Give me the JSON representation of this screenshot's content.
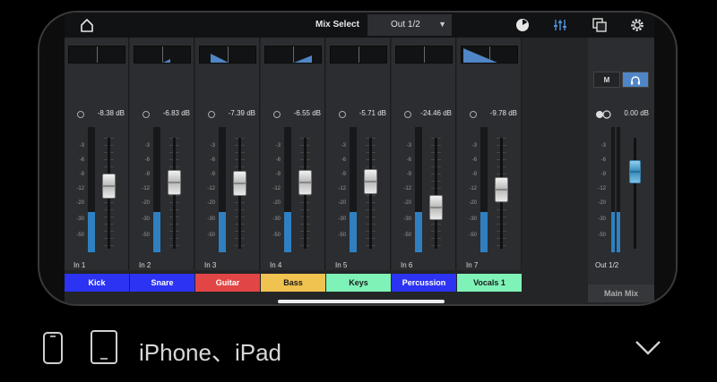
{
  "topbar": {
    "mix_select_label": "Mix Select",
    "output_value": "Out 1/2",
    "icons": [
      "home-icon",
      "knob-icon",
      "faders-icon",
      "copy-icon",
      "gear-icon"
    ]
  },
  "channels": [
    {
      "name": "Kick",
      "input": "In 1",
      "db": "-8.38 dB",
      "color": "#2c33f2",
      "text_color": "#ffffff",
      "fader_level": 0.58,
      "meter_level": 0.32,
      "pan": "center"
    },
    {
      "name": "Snare",
      "input": "In 2",
      "db": "-6.83 dB",
      "color": "#2c33f2",
      "text_color": "#ffffff",
      "fader_level": 0.62,
      "meter_level": 0.32,
      "pan": "slight-right"
    },
    {
      "name": "Guitar",
      "input": "In 3",
      "db": "-7.39 dB",
      "color": "#e24545",
      "text_color": "#ffffff",
      "fader_level": 0.61,
      "meter_level": 0.32,
      "pan": "left"
    },
    {
      "name": "Bass",
      "input": "In 4",
      "db": "-6.55 dB",
      "color": "#f0c24f",
      "text_color": "#1a1a1a",
      "fader_level": 0.62,
      "meter_level": 0.32,
      "pan": "right"
    },
    {
      "name": "Keys",
      "input": "In 5",
      "db": "-5.71 dB",
      "color": "#7ff2b7",
      "text_color": "#1a1a1a",
      "fader_level": 0.64,
      "meter_level": 0.32,
      "pan": "center"
    },
    {
      "name": "Percussion",
      "input": "In 6",
      "db": "-24.46 dB",
      "color": "#2c33f2",
      "text_color": "#ffffff",
      "fader_level": 0.33,
      "meter_level": 0.32,
      "pan": "center"
    },
    {
      "name": "Vocals 1",
      "input": "In 7",
      "db": "-9.78 dB",
      "color": "#7ff2b7",
      "text_color": "#1a1a1a",
      "fader_level": 0.54,
      "meter_level": 0.32,
      "pan": "wide-left"
    }
  ],
  "scale_labels": [
    "-3",
    "-6",
    "-9",
    "-12",
    "-20",
    "-30",
    "-50"
  ],
  "master": {
    "mute_label": "M",
    "monitor_icon": "headphones-icon",
    "db": "0.00 dB",
    "output": "Out 1/2",
    "name": "Main Mix",
    "fader_level": 0.75,
    "meter_level": 0.32
  },
  "bottom": {
    "device_label": "iPhone、iPad",
    "icons": [
      "phone-icon",
      "tablet-icon",
      "chevron-down-icon"
    ]
  }
}
